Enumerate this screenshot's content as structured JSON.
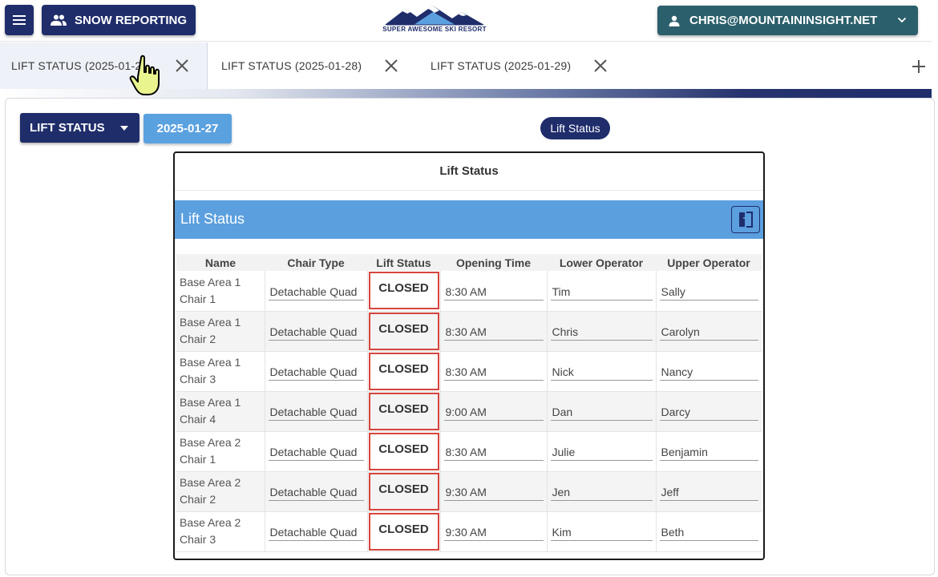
{
  "header": {
    "menu_icon": "hamburger-menu-icon",
    "report_button_label": "SNOW REPORTING",
    "logo_text": "SUPER AWESOME SKI RESORT",
    "user_label": "CHRIS@MOUNTAININSIGHT.NET"
  },
  "tabs": [
    {
      "label": "LIFT STATUS (2025-01-27)",
      "active": true
    },
    {
      "label": "LIFT STATUS (2025-01-28)",
      "active": false
    },
    {
      "label": "LIFT STATUS (2025-01-29)",
      "active": false
    }
  ],
  "toolbar": {
    "report_select_label": "LIFT STATUS",
    "date_label": "2025-01-27",
    "report_pill_label": "Lift Status"
  },
  "report": {
    "title": "Lift Status",
    "section_title": "Lift Status",
    "columns": [
      "Name",
      "Chair Type",
      "Lift Status",
      "Opening Time",
      "Lower Operator",
      "Upper Operator"
    ],
    "rows": [
      {
        "name_line1": "Base Area 1",
        "name_line2": "Chair 1",
        "chair_type": "Detachable Quad",
        "status": "CLOSED",
        "opening_time": "8:30 AM",
        "lower_operator": "Tim",
        "upper_operator": "Sally"
      },
      {
        "name_line1": "Base Area 1",
        "name_line2": "Chair 2",
        "chair_type": "Detachable Quad",
        "status": "CLOSED",
        "opening_time": "8:30 AM",
        "lower_operator": "Chris",
        "upper_operator": "Carolyn"
      },
      {
        "name_line1": "Base Area 1",
        "name_line2": "Chair 3",
        "chair_type": "Detachable Quad",
        "status": "CLOSED",
        "opening_time": "8:30 AM",
        "lower_operator": "Nick",
        "upper_operator": "Nancy"
      },
      {
        "name_line1": "Base Area 1",
        "name_line2": "Chair 4",
        "chair_type": "Detachable Quad",
        "status": "CLOSED",
        "opening_time": "9:00 AM",
        "lower_operator": "Dan",
        "upper_operator": "Darcy"
      },
      {
        "name_line1": "Base Area 2",
        "name_line2": "Chair 1",
        "chair_type": "Detachable Quad",
        "status": "CLOSED",
        "opening_time": "8:30 AM",
        "lower_operator": "Julie",
        "upper_operator": "Benjamin"
      },
      {
        "name_line1": "Base Area 2",
        "name_line2": "Chair 2",
        "chair_type": "Detachable Quad",
        "status": "CLOSED",
        "opening_time": "9:30 AM",
        "lower_operator": "Jen",
        "upper_operator": "Jeff"
      },
      {
        "name_line1": "Base Area 2",
        "name_line2": "Chair 3",
        "chair_type": "Detachable Quad",
        "status": "CLOSED",
        "opening_time": "9:30 AM",
        "lower_operator": "Kim",
        "upper_operator": "Beth"
      }
    ]
  },
  "colors": {
    "navy": "#1f2d6b",
    "teal": "#2b5f6b",
    "blue_header": "#5b9fdf",
    "date_chip": "#5aa1e0",
    "closed_border": "#d6453d"
  }
}
